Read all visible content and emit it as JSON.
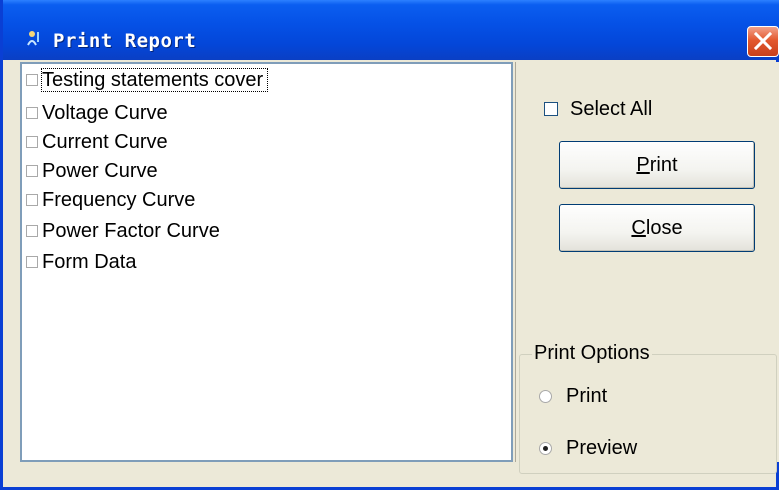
{
  "window": {
    "title": "Print Report",
    "close_icon": "close-icon",
    "app_icon": "app-icon"
  },
  "report_list": {
    "items": [
      {
        "label": "Testing statements cover",
        "checked": false,
        "focused": true
      },
      {
        "label": "Voltage Curve",
        "checked": false
      },
      {
        "label": "Current Curve",
        "checked": false
      },
      {
        "label": "Power Curve",
        "checked": false
      },
      {
        "label": "Frequency Curve",
        "checked": false
      },
      {
        "label": "Power Factor Curve",
        "checked": false
      },
      {
        "label": "Form Data",
        "checked": false
      }
    ]
  },
  "controls": {
    "select_all_label": "Select All",
    "select_all_checked": false,
    "print_button": {
      "mnemonic": "P",
      "rest": "rint"
    },
    "close_button": {
      "mnemonic": "C",
      "rest": "lose"
    }
  },
  "print_options": {
    "title": "Print Options",
    "options": [
      {
        "label": "Print",
        "selected": false
      },
      {
        "label": "Preview",
        "selected": true
      }
    ]
  },
  "colors": {
    "titlebar": "#0551e6",
    "dialog_bg": "#ece9d8",
    "close_red": "#e3592f"
  }
}
